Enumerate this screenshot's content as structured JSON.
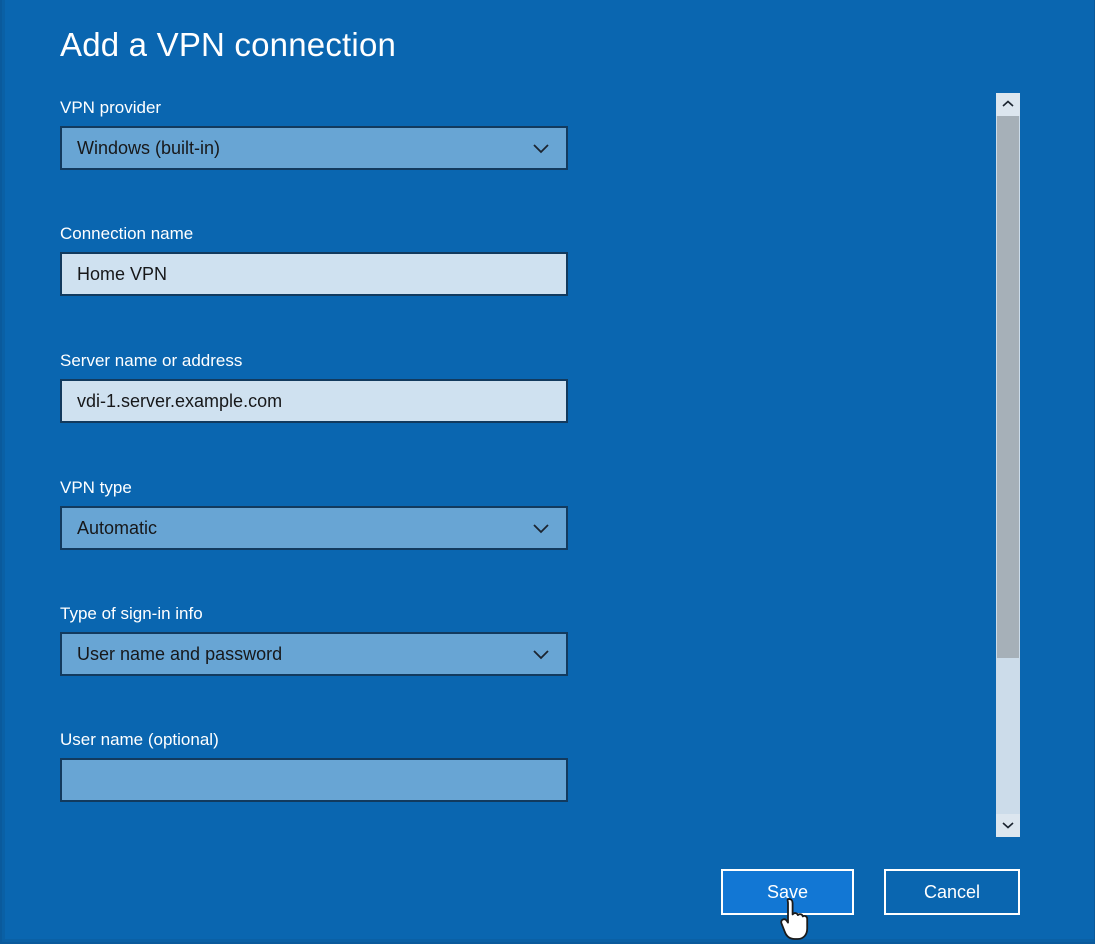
{
  "dialog": {
    "title": "Add a VPN connection",
    "background_color": "#0a66b0"
  },
  "fields": [
    {
      "label": "VPN provider",
      "type": "dropdown",
      "value": "Windows (built-in)",
      "placeholder": "",
      "icon": "chevron-down-icon",
      "name": "vpn-provider"
    },
    {
      "label": "Connection name",
      "type": "textbox",
      "value": "Home VPN",
      "placeholder": "",
      "icon": "",
      "name": "connection-name"
    },
    {
      "label": "Server name or address",
      "type": "textbox",
      "value": "vdi-1.server.example.com",
      "placeholder": "",
      "icon": "",
      "name": "server-name"
    },
    {
      "label": "VPN type",
      "type": "dropdown",
      "value": "Automatic",
      "placeholder": "",
      "icon": "chevron-down-icon",
      "name": "vpn-type"
    },
    {
      "label": "Type of sign-in info",
      "type": "dropdown",
      "value": "User name and password",
      "placeholder": "",
      "icon": "chevron-down-icon",
      "name": "sign-in-type"
    },
    {
      "label": "User name (optional)",
      "type": "empty",
      "value": "",
      "placeholder": "",
      "icon": "",
      "name": "user-name"
    }
  ],
  "buttons": {
    "save_label": "Save",
    "cancel_label": "Cancel",
    "save_color": "#1277d4"
  },
  "scrollbar": {
    "up_arrow": "chevron-up-icon",
    "down_arrow": "chevron-down-icon",
    "thumb_color": "#a6b0b8",
    "track_color": "#ccdcea"
  },
  "cursor": {
    "type": "pointing-hand-cursor"
  }
}
